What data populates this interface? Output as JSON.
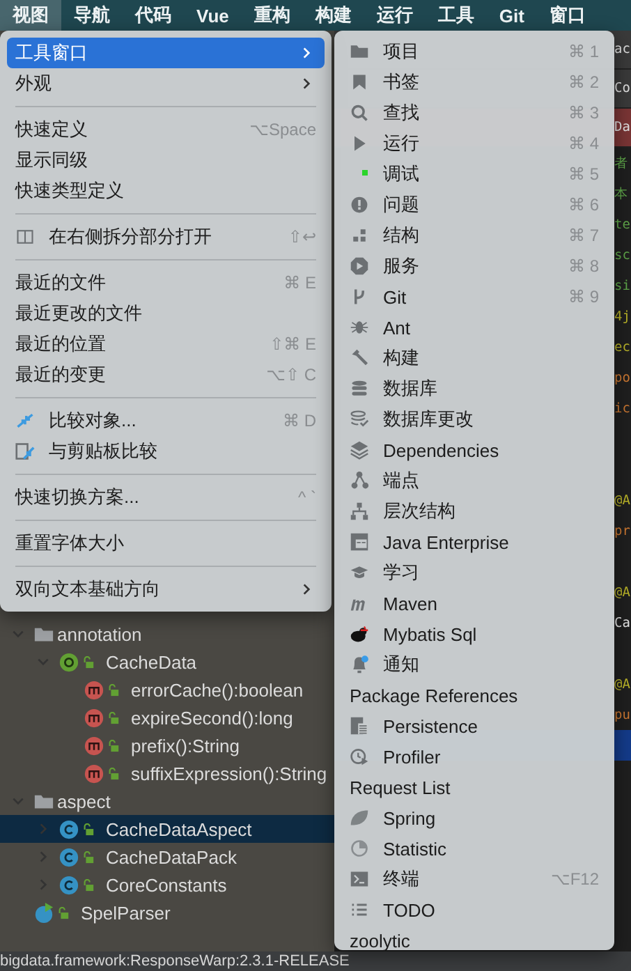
{
  "menu_bar": [
    {
      "label": "视图",
      "selected": true
    },
    {
      "label": "导航",
      "selected": false
    },
    {
      "label": "代码",
      "selected": false
    },
    {
      "label": "Vue",
      "selected": false
    },
    {
      "label": "重构",
      "selected": false
    },
    {
      "label": "构建",
      "selected": false
    },
    {
      "label": "运行",
      "selected": false
    },
    {
      "label": "工具",
      "selected": false
    },
    {
      "label": "Git",
      "selected": false
    },
    {
      "label": "窗口",
      "selected": false
    }
  ],
  "view_menu": {
    "items": [
      {
        "kind": "item",
        "label": "工具窗口",
        "submenu": true,
        "selected": true
      },
      {
        "kind": "item",
        "label": "外观",
        "submenu": true,
        "selected": false
      },
      {
        "kind": "separator"
      },
      {
        "kind": "item",
        "label": "快速定义",
        "shortcut": "⌥Space",
        "selected": false
      },
      {
        "kind": "item",
        "label": "显示同级",
        "selected": false
      },
      {
        "kind": "item",
        "label": "快速类型定义",
        "selected": false
      },
      {
        "kind": "separator"
      },
      {
        "kind": "item",
        "label": "在右侧拆分部分打开",
        "shortcut": "⇧↩",
        "selected": false
      },
      {
        "kind": "separator"
      },
      {
        "kind": "item",
        "label": "最近的文件",
        "shortcut": "⌘ E",
        "selected": false
      },
      {
        "kind": "item",
        "label": "最近更改的文件",
        "selected": false
      },
      {
        "kind": "item",
        "label": "最近的位置",
        "shortcut": "⇧⌘ E",
        "selected": false
      },
      {
        "kind": "item",
        "label": "最近的变更",
        "shortcut": "⌥⇧ C",
        "selected": false
      },
      {
        "kind": "separator"
      },
      {
        "kind": "item",
        "label": "比较对象...",
        "shortcut": "⌘ D",
        "selected": false
      },
      {
        "kind": "item",
        "label": "与剪贴板比较",
        "selected": false
      },
      {
        "kind": "separator"
      },
      {
        "kind": "item",
        "label": "快速切换方案...",
        "shortcut": "^ `",
        "selected": false
      },
      {
        "kind": "separator"
      },
      {
        "kind": "item",
        "label": "重置字体大小",
        "selected": false
      },
      {
        "kind": "separator"
      },
      {
        "kind": "item",
        "label": "双向文本基础方向",
        "submenu": true,
        "selected": false
      }
    ]
  },
  "tool_windows_menu": {
    "items": [
      {
        "label": "项目",
        "shortcut": "⌘ 1"
      },
      {
        "label": "书签",
        "shortcut": "⌘ 2"
      },
      {
        "label": "查找",
        "shortcut": "⌘ 3"
      },
      {
        "label": "运行",
        "shortcut": "⌘ 4"
      },
      {
        "label": "调试",
        "shortcut": "⌘ 5"
      },
      {
        "label": "问题",
        "shortcut": "⌘ 6"
      },
      {
        "label": "结构",
        "shortcut": "⌘ 7"
      },
      {
        "label": "服务",
        "shortcut": "⌘ 8"
      },
      {
        "label": "Git",
        "shortcut": "⌘ 9"
      },
      {
        "label": "Ant"
      },
      {
        "label": "构建"
      },
      {
        "label": "数据库"
      },
      {
        "label": "数据库更改"
      },
      {
        "label": "Dependencies"
      },
      {
        "label": "端点"
      },
      {
        "label": "层次结构"
      },
      {
        "label": "Java Enterprise"
      },
      {
        "label": "学习"
      },
      {
        "label": "Maven"
      },
      {
        "label": "Mybatis Sql"
      },
      {
        "label": "通知"
      },
      {
        "label": "Package References"
      },
      {
        "label": "Persistence"
      },
      {
        "label": "Profiler"
      },
      {
        "label": "Request List"
      },
      {
        "label": "Spring"
      },
      {
        "label": "Statistic"
      },
      {
        "label": "终端",
        "shortcut": "⌥F12"
      },
      {
        "label": "TODO"
      },
      {
        "label": "zoolytic"
      }
    ]
  },
  "project_tree": [
    {
      "label": "annotation",
      "kind": "folder",
      "expanded": true,
      "children": [
        {
          "label": "CacheData",
          "kind": "annotation",
          "expanded": true,
          "selected": false,
          "children": [
            {
              "label": "errorCache():boolean",
              "kind": "method",
              "selected": false
            },
            {
              "label": "expireSecond():long",
              "kind": "method",
              "selected": false
            },
            {
              "label": "prefix():String",
              "kind": "method",
              "selected": false
            },
            {
              "label": "suffixExpression():String",
              "kind": "method",
              "selected": false
            }
          ]
        }
      ]
    },
    {
      "label": "aspect",
      "kind": "folder",
      "expanded": true,
      "children": [
        {
          "label": "CacheDataAspect",
          "kind": "class",
          "expanded": false,
          "selected": true
        },
        {
          "label": "CacheDataPack",
          "kind": "class",
          "expanded": false,
          "selected": false
        },
        {
          "label": "CoreConstants",
          "kind": "class",
          "expanded": false,
          "selected": false
        }
      ]
    },
    {
      "label": "SpelParser",
      "kind": "runnable",
      "selected": false
    }
  ],
  "editor_lines": [
    {
      "text": "ac",
      "kind": "tab"
    },
    {
      "text": "Co",
      "kind": "tab"
    },
    {
      "text": "Da",
      "kind": "active-tab"
    },
    {
      "text": "者",
      "kind": "comment"
    },
    {
      "text": "本",
      "kind": "comment"
    },
    {
      "text": "te",
      "kind": "comment"
    },
    {
      "text": "sc",
      "kind": "comment"
    },
    {
      "text": "si",
      "kind": "comment"
    },
    {
      "text": "4j",
      "kind": "annotation"
    },
    {
      "text": "ec",
      "kind": "annotation"
    },
    {
      "text": "po",
      "kind": "keyword"
    },
    {
      "text": "ic",
      "kind": "keyword"
    },
    {
      "kind": "blank"
    },
    {
      "kind": "blank"
    },
    {
      "text": "@A",
      "kind": "annotation"
    },
    {
      "text": "pr",
      "kind": "keyword"
    },
    {
      "kind": "blank"
    },
    {
      "text": "@A",
      "kind": "annotation"
    },
    {
      "text": "Ca",
      "kind": "plain"
    },
    {
      "kind": "blank"
    },
    {
      "text": "@A",
      "kind": "annotation"
    },
    {
      "text": "pu",
      "kind": "keyword"
    },
    {
      "kind": "selected"
    }
  ],
  "status_bar": {
    "text": "bigdata.framework:ResponseWarp:2.3.1-RELEASE"
  }
}
